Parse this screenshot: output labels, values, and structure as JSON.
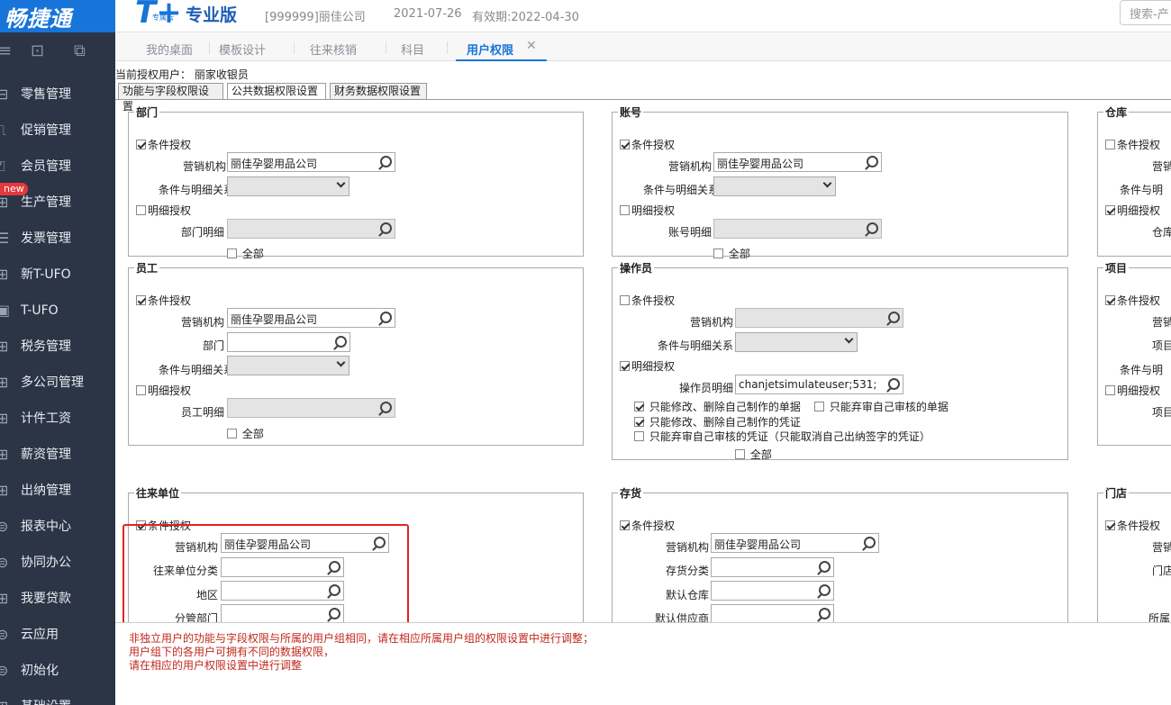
{
  "app": {
    "logo": "畅捷通",
    "product_logo": "T+",
    "product_logo_sub": "专属云",
    "edition": "专业版",
    "company": "[999999]丽佳公司",
    "date": "2021-07-26",
    "expiry": "有效期:2022-04-30",
    "search_placeholder": "搜索-产"
  },
  "sidebar": {
    "new_badge": "new",
    "items": [
      {
        "label": "零售管理",
        "icon": "retail-icon"
      },
      {
        "label": "促销管理",
        "icon": "promotion-icon"
      },
      {
        "label": "会员管理",
        "icon": "member-icon"
      },
      {
        "label": "生产管理",
        "icon": "production-icon"
      },
      {
        "label": "发票管理",
        "icon": "invoice-icon"
      },
      {
        "label": "新T-UFO",
        "icon": "new-tufo-icon"
      },
      {
        "label": "T-UFO",
        "icon": "tufo-icon"
      },
      {
        "label": "税务管理",
        "icon": "tax-icon"
      },
      {
        "label": "多公司管理",
        "icon": "multi-company-icon"
      },
      {
        "label": "计件工资",
        "icon": "piecework-icon"
      },
      {
        "label": "薪资管理",
        "icon": "salary-icon"
      },
      {
        "label": "出纳管理",
        "icon": "cashier-icon"
      },
      {
        "label": "报表中心",
        "icon": "report-icon"
      },
      {
        "label": "协同办公",
        "icon": "collab-icon"
      },
      {
        "label": "我要贷款",
        "icon": "loan-icon"
      },
      {
        "label": "云应用",
        "icon": "cloud-app-icon"
      },
      {
        "label": "初始化",
        "icon": "init-icon"
      },
      {
        "label": "基础设置",
        "icon": "settings-icon"
      }
    ]
  },
  "tabs": [
    "我的桌面",
    "模板设计",
    "往来核销",
    "科目",
    "用户权限"
  ],
  "content": {
    "current_user": "当前授权用户： 丽家收银员",
    "subtabs": [
      "功能与字段权限设置",
      "公共数据权限设置",
      "财务数据权限设置"
    ],
    "common": {
      "cond_auth": "条件授权",
      "detail_auth": "明细授权",
      "all": "全部",
      "marketing_org": "营销机构",
      "cond_detail_rel": "条件与明细关系",
      "company_value": "丽佳孕婴用品公司"
    },
    "dept": {
      "title": "部门",
      "detail": "部门明细"
    },
    "account": {
      "title": "账号",
      "detail": "账号明细"
    },
    "warehouse": {
      "title": "仓库",
      "marketing": "营销",
      "rel": "条件与明",
      "detail": "仓库"
    },
    "employee": {
      "title": "员工",
      "dept": "部门",
      "detail": "员工明细"
    },
    "operator": {
      "title": "操作员",
      "detail": "操作员明细",
      "detail_value": "chanjetsimulateuser;531;",
      "opt1": "只能修改、删除自己制作的单据",
      "opt2": "只能弃审自己审核的单据",
      "opt3": "只能修改、删除自己制作的凭证",
      "opt4": "只能弃审自己审核的凭证（只能取消自己出纳签字的凭证）"
    },
    "project": {
      "title": "项目",
      "marketing": "营销",
      "item": "项目",
      "rel": "条件与明",
      "detail": "项目"
    },
    "partner": {
      "title": "往来单位",
      "category": "往来单位分类",
      "region": "地区",
      "dept": "分管部门"
    },
    "inventory": {
      "title": "存货",
      "category": "存货分类",
      "warehouse": "默认仓库",
      "supplier": "默认供应商"
    },
    "store": {
      "title": "门店",
      "marketing": "营销",
      "store": "门店",
      "belong": "所属"
    },
    "notes": [
      "非独立用户的功能与字段权限与所属的用户组相同，请在相应所属用户组的权限设置中进行调整；",
      "用户组下的各用户可拥有不同的数据权限，",
      "请在相应的用户权限设置中进行调整"
    ]
  },
  "colors": {
    "brand": "#1775d9",
    "sidebar": "#2c3546",
    "highlight": "#e02424",
    "note": "#c0281e"
  }
}
